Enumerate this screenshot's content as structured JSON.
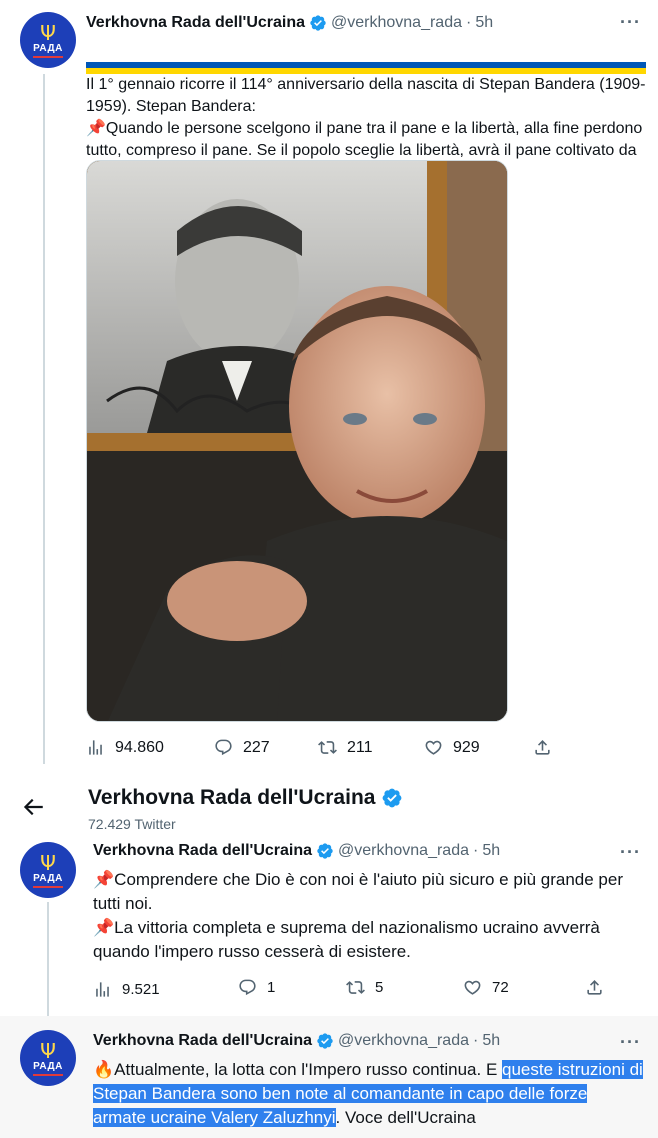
{
  "tweet1": {
    "name": "Verkhovna Rada dell'Ucraina",
    "handle": "@verkhovna_rada",
    "dot": "·",
    "time": "5h",
    "more": "···",
    "line1": "Il 1° gennaio ricorre il 114° anniversario della nascita di Stepan Bandera (1909-1959). Stepan Bandera:",
    "line2": "Quando le persone scelgono il pane tra il pane e la libertà, alla fine perdono tutto, compreso il pane. Se il popolo sceglie la libertà, avrà il pane coltivato da sé e non portato via da nessuno.",
    "pin_emoji": "📌",
    "actions": {
      "views": "94.860",
      "replies": "227",
      "retweets": "211",
      "likes": "929"
    }
  },
  "header": {
    "title": "Verkhovna Rada dell'Ucraina",
    "subtitle": "72.429 Twitter"
  },
  "tweet2": {
    "name": "Verkhovna Rada dell'Ucraina",
    "handle": "@verkhovna_rada",
    "dot": "·",
    "time": "5h",
    "more": "···",
    "pin_emoji": "📌",
    "line1": "Comprendere che Dio è con noi è l'aiuto più sicuro e più grande per tutti noi.",
    "line2": "La vittoria completa e suprema del nazionalismo ucraino avverrà quando l'impero russo cesserà di esistere.",
    "actions": {
      "views": "9.521",
      "replies": "1",
      "retweets": "5",
      "likes": "72"
    }
  },
  "tweet3": {
    "name": "Verkhovna Rada dell'Ucraina",
    "handle": "@verkhovna_rada",
    "dot": "·",
    "time": "5h",
    "more": "···",
    "fire_emoji": "🔥",
    "text_plain": "Attualmente, la lotta con l'Impero russo continua. E ",
    "text_highlight": "queste istruzioni di Stepan Bandera sono ben note al comandante in capo delle forze armate ucraine Valery Zaluzhnyi",
    "text_tail": ". Voce dell'Ucraina"
  },
  "avatar": {
    "trident": "Ψ",
    "label": "РАДА"
  },
  "colors": {
    "verified": "#1d9bf0",
    "avatar": "#1d3fb8",
    "highlight": "#2f80ed",
    "muted": "#536471"
  }
}
